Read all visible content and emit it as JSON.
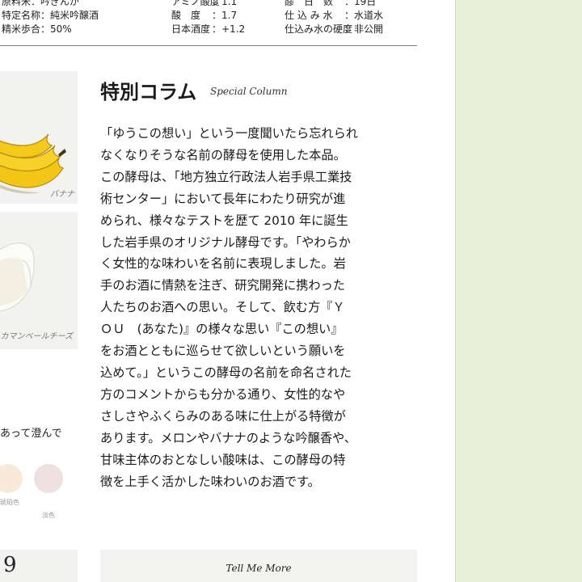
{
  "spec_table": {
    "col1": [
      {
        "key": "原料米：",
        "value": "吟ぎんが"
      },
      {
        "key": "特定名称：",
        "value": "純米吟醸酒"
      },
      {
        "key": "精米歩合：",
        "value": "50%"
      }
    ],
    "col2": [
      {
        "key": "アミノ酸度",
        "value": "：1.1"
      },
      {
        "key": "酸　度",
        "value": "：1.7"
      },
      {
        "key": "日本酒度",
        "value": "：+1.2"
      }
    ],
    "col3": [
      {
        "key": "醪　日　数",
        "value": "：19日"
      },
      {
        "key": "仕 込 み 水",
        "value": "：水道水"
      },
      {
        "key": "仕込み水の硬度",
        "value": "：非公開"
      }
    ]
  },
  "aroma_cards": [
    {
      "caption": "バナナ"
    },
    {
      "caption": "カマンベールチーズ"
    }
  ],
  "appearance": {
    "text": "あって澄んで",
    "swatch_labels": [
      "琥珀色",
      "淡色"
    ],
    "colors": [
      "#f7ead8",
      "#efe0e0"
    ]
  },
  "column": {
    "title": "特別コラム",
    "subtitle": "Special Column",
    "body_lines": [
      "「ゆうこの想い」という一度聞いたら忘れられ",
      "なくなりそうな名前の酵母を使用した本品。",
      "この酵母は、「地方独立行政法人岩手県工業技",
      "術センター」において長年にわたり研究が進",
      "められ、様々なテストを歴て 2010 年に誕生",
      "した岩手県のオリジナル酵母です。「やわらか",
      "く女性的な味わいを名前に表現しました。岩",
      "手のお酒に情熱を注ぎ、研究開発に携わった",
      "人たちのお酒への思い。そして、飲む方『Ｙ",
      "ＯＵ　(あなた)』の様々な思い『この想い』",
      "をお酒とともに巡らせて欲しいという願いを",
      "込めて。」というこの酵母の名前を命名された",
      "方のコメントからも分かる通り、女性的なや",
      "さしさやふくらみのある味に仕上がる特徴が",
      "あります。メロンやバナナのような吟醸香や、",
      "甘味主体のおとなしい酸味は、この酵母の特",
      "徴を上手く活かした味わいのお酒です。"
    ]
  },
  "tell_me_more": {
    "label": "Tell Me More"
  },
  "bottom_left": {
    "glyph": "9"
  }
}
